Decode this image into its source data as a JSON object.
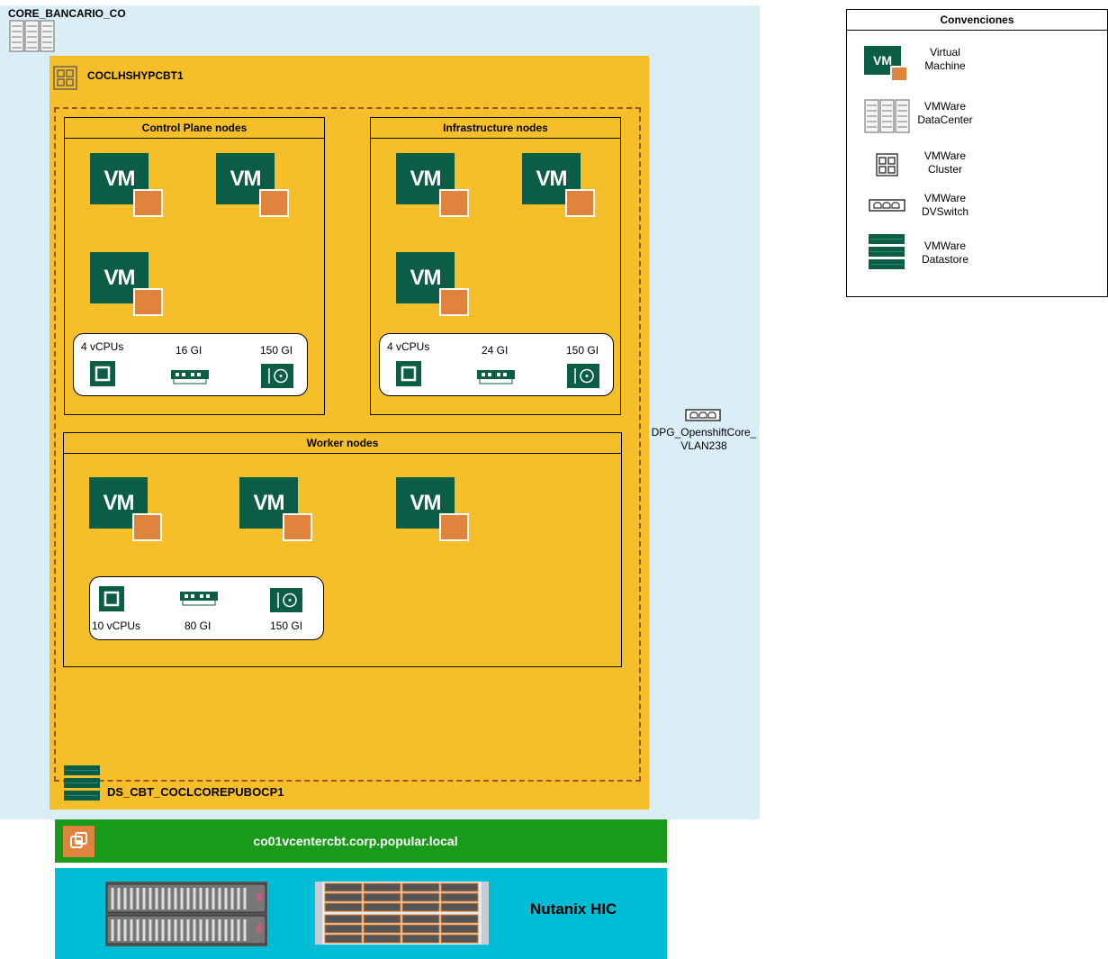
{
  "datacenter": {
    "name": "CORE_BANCARIO_CO",
    "icon": "datacenter-icon",
    "color": "#daeef8"
  },
  "cluster": {
    "name": "COCLHSHYPCBT1",
    "icon": "cluster-icon",
    "color": "#f6bf2a"
  },
  "datastore": {
    "name": "DS_CBT_COCLCOREPUBOCP1",
    "icon": "datastore-icon"
  },
  "port_group": {
    "name": "DPG_OpenshiftCore_\nVLAN238",
    "icon": "dvswitch-icon"
  },
  "vm_label": "VM",
  "control_plane": {
    "title": "Control Plane nodes",
    "specs": {
      "cpu": "4 vCPUs",
      "memory": "16 GI",
      "disk": "150 GI"
    }
  },
  "infrastructure": {
    "title": "Infrastructure nodes",
    "specs": {
      "cpu": "4 vCPUs",
      "memory": "24 GI",
      "disk": "150 GI"
    }
  },
  "worker": {
    "title": "Worker nodes",
    "specs": {
      "cpu": "10 vCPUs",
      "memory": "80 GI",
      "disk": "150 GI"
    }
  },
  "vcenter": {
    "name": "co01vcentercbt.corp.popular.local",
    "icon": "vcenter-icon",
    "color": "#1a9a1a"
  },
  "hardware": {
    "name": "Nutanix HIC",
    "color": "#00bcd4"
  },
  "legend": {
    "title": "Convenciones",
    "items": [
      {
        "label": "Virtual\nMachine",
        "icon": "vm-icon"
      },
      {
        "label": "VMWare\nDataCenter",
        "icon": "datacenter-icon"
      },
      {
        "label": "VMWare\nCluster",
        "icon": "cluster-icon"
      },
      {
        "label": "VMWare\nDVSwitch",
        "icon": "dvswitch-icon"
      },
      {
        "label": "VMWare\nDatastore",
        "icon": "datastore-icon"
      }
    ]
  }
}
